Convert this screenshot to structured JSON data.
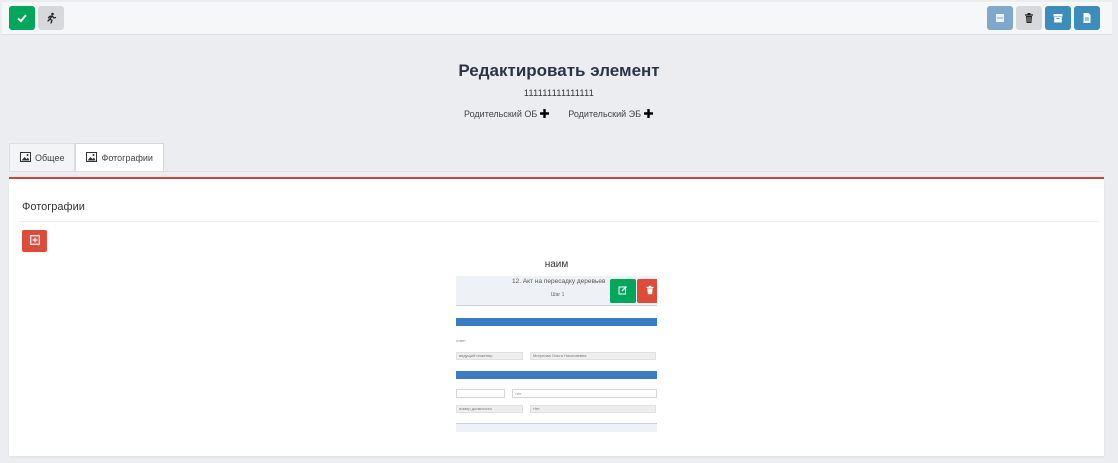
{
  "colors": {
    "success": "#00a65a",
    "danger": "#dd4b39",
    "primary": "#3c8dbc",
    "primary_light": "#7ea9cc",
    "panel_accent": "#c9443b"
  },
  "toolbar": {
    "left_buttons": [
      {
        "name": "save-button",
        "icon": "check-icon"
      },
      {
        "name": "exit-button",
        "icon": "running-man-icon"
      }
    ],
    "right_buttons": [
      {
        "name": "list-button",
        "icon": "list-icon"
      },
      {
        "name": "delete-button",
        "icon": "trash-icon"
      },
      {
        "name": "archive-button",
        "icon": "archive-icon"
      },
      {
        "name": "document-button",
        "icon": "file-icon"
      }
    ]
  },
  "header": {
    "title": "Редактировать элемент",
    "code": "111111111111111",
    "parents": [
      {
        "label": "Родительский ОБ",
        "icon": "plus-icon"
      },
      {
        "label": "Родительский ЭБ",
        "icon": "plus-icon"
      }
    ]
  },
  "tabs": [
    {
      "label": "Общее",
      "icon": "image-icon",
      "active": false
    },
    {
      "label": "Фотографии",
      "icon": "image-icon",
      "active": true
    }
  ],
  "panel": {
    "title": "Фотографии",
    "add_icon": "plus-square-icon"
  },
  "photo": {
    "caption": "наим",
    "document": {
      "title": "12. Акт на пересадку деревьев",
      "subtitle": "Шаг 1",
      "field_1": "Мигунова Ольга Николаевна",
      "label_1": "ответ",
      "label_2": "ведущий инженер",
      "label_3": "тип",
      "label_4": "номер должности",
      "field_2": "Нет"
    },
    "edit_icon": "edit-icon",
    "delete_icon": "trash-icon"
  }
}
